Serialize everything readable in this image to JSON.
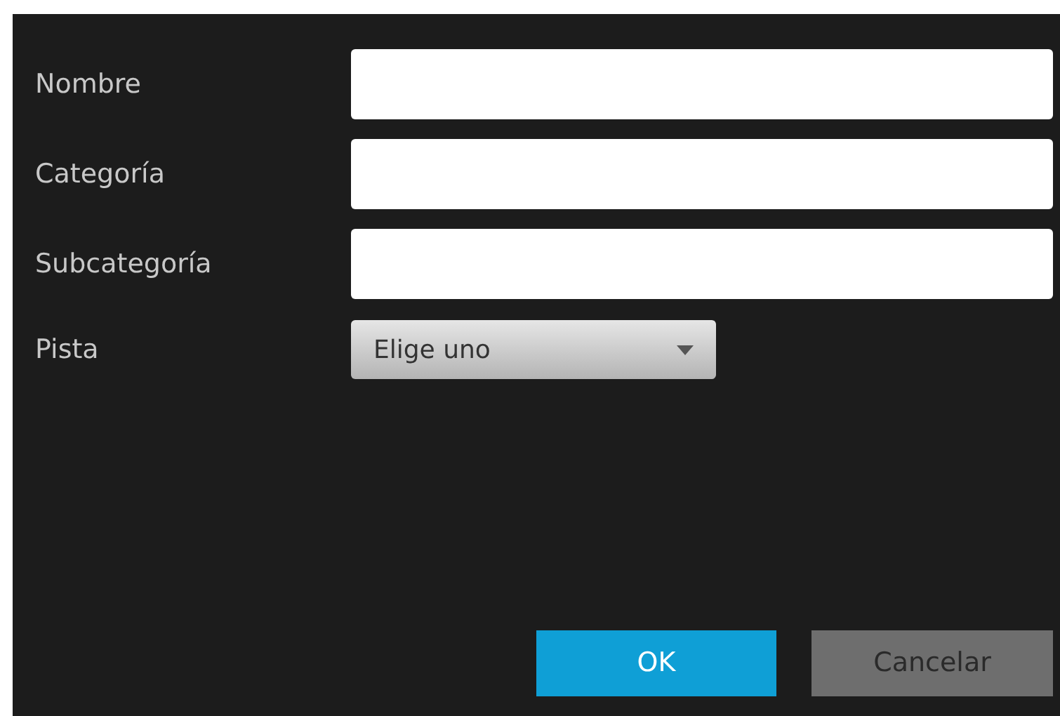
{
  "fields": [
    {
      "label": "Nombre",
      "kind": "text"
    },
    {
      "label": "Categoría",
      "kind": "text"
    },
    {
      "label": "Subcategoría",
      "kind": "text"
    },
    {
      "label": "Pista",
      "kind": "select",
      "value": "Elige uno"
    }
  ],
  "buttons": [
    {
      "label": "OK",
      "kind": "primary"
    },
    {
      "label": "Cancelar",
      "kind": "secondary"
    }
  ]
}
